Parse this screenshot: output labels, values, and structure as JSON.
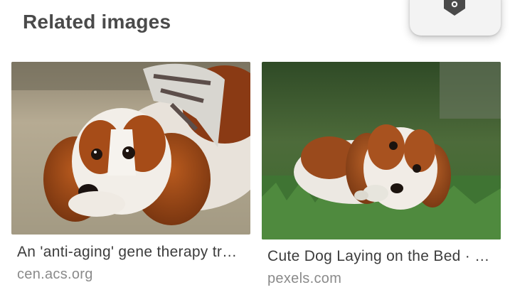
{
  "section": {
    "title": "Related images"
  },
  "floating_action": {
    "icon": "lens-icon"
  },
  "results": [
    {
      "caption": "An 'anti-aging' gene therapy tr…",
      "source": "cen.acs.org",
      "image_alt": "Cavalier King Charles spaniel lying on sand wearing a patterned bandana"
    },
    {
      "caption": "Cute Dog Laying on the Bed · …",
      "source": "pexels.com",
      "image_alt": "Cavalier spaniel puppy lying on grass chewing a toy"
    }
  ],
  "colors": {
    "title": "#4a4a4a",
    "caption": "#3c3c3c",
    "source": "#8a8a8a",
    "card": "#f3f3f3"
  }
}
